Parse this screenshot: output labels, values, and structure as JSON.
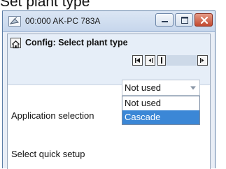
{
  "caption": "Set plant type",
  "window": {
    "title": "00:000 AK-PC 783A",
    "app_icon": "satellite-dish-icon",
    "controls": {
      "minimize": "minimize-icon",
      "maximize": "maximize-icon",
      "close": "close-icon"
    }
  },
  "panel": {
    "home_icon": "home-icon",
    "title": "Config: Select plant type",
    "nav": {
      "first": "skip-first-icon",
      "prev": "step-back-icon",
      "position": "position-marker-icon",
      "next": "step-forward-icon"
    }
  },
  "fields": {
    "application_label": "Application selection",
    "application_value": "Not used",
    "options": [
      "Not used",
      "Cascade"
    ],
    "highlighted_option": "Cascade",
    "quick_setup_label": "Select quick setup"
  },
  "colors": {
    "selection": "#3b87d6",
    "panel_background": "#e6eef8",
    "close_button": "#c24a30"
  }
}
